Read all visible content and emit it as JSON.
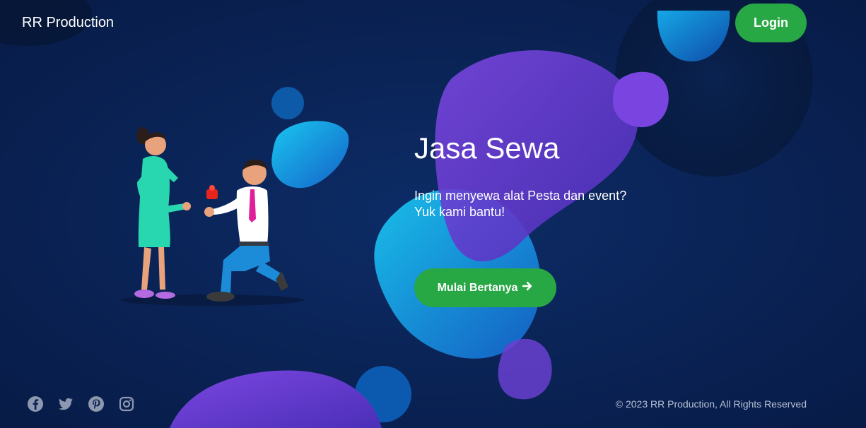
{
  "brand": {
    "name": "RR Production"
  },
  "header": {
    "login_label": "Login"
  },
  "hero": {
    "title": "Jasa Sewa",
    "subtitle_line1": "Ingin menyewa alat Pesta dan event?",
    "subtitle_line2": "Yuk kami bantu!",
    "cta_label": "Mulai Bertanya",
    "cta_icon": "arrow-right-icon"
  },
  "footer": {
    "social": [
      {
        "name": "facebook",
        "icon": "facebook-icon"
      },
      {
        "name": "twitter",
        "icon": "twitter-icon"
      },
      {
        "name": "pinterest",
        "icon": "pinterest-icon"
      },
      {
        "name": "instagram",
        "icon": "instagram-icon"
      }
    ],
    "copyright": "© 2023 RR Production, All Rights Reserved"
  },
  "colors": {
    "background": "#0a2356",
    "accent_green": "#28a745",
    "blob_purple": "#6a3fd6",
    "blob_cyan": "#1da1e6"
  }
}
